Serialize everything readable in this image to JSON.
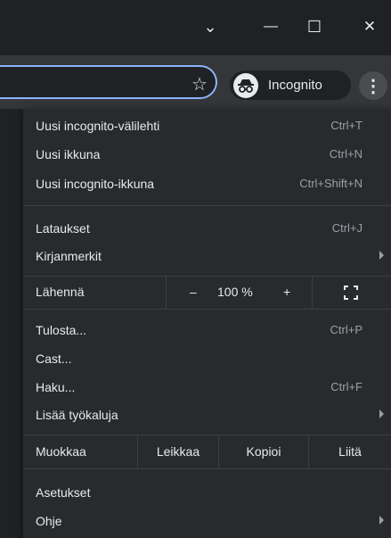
{
  "window": {
    "controls": [
      {
        "name": "tab-search-icon",
        "glyph": "⌄"
      },
      {
        "name": "minimize-icon",
        "glyph": "—"
      },
      {
        "name": "maximize-icon",
        "glyph": "☐"
      },
      {
        "name": "close-icon",
        "glyph": "✕"
      }
    ]
  },
  "toolbar": {
    "star_glyph": "☆",
    "incognito_label": "Incognito",
    "menu_glyph": "⋮"
  },
  "menu": {
    "group1": [
      {
        "label": "Uusi incognito-välilehti",
        "shortcut": "Ctrl+T"
      },
      {
        "label": "Uusi ikkuna",
        "shortcut": "Ctrl+N"
      },
      {
        "label": "Uusi incognito-ikkuna",
        "shortcut": "Ctrl+Shift+N"
      }
    ],
    "group2": [
      {
        "label": "Lataukset",
        "shortcut": "Ctrl+J"
      },
      {
        "label": "Kirjanmerkit",
        "shortcut": ""
      }
    ],
    "zoom": {
      "label": "Lähennä",
      "minus": "–",
      "value": "100 %",
      "plus": "+"
    },
    "group3": [
      {
        "label": "Tulosta...",
        "shortcut": "Ctrl+P"
      },
      {
        "label": "Cast...",
        "shortcut": ""
      },
      {
        "label": "Haku...",
        "shortcut": "Ctrl+F"
      },
      {
        "label": "Lisää työkaluja",
        "shortcut": ""
      }
    ],
    "edit": {
      "label": "Muokkaa",
      "cut": "Leikkaa",
      "copy": "Kopioi",
      "paste": "Liitä"
    },
    "group4": [
      {
        "label": "Asetukset",
        "shortcut": ""
      },
      {
        "label": "Ohje",
        "shortcut": ""
      }
    ]
  },
  "colors": {
    "accent": "#8ab4f8",
    "menu_bg": "#292a2d",
    "toolbar_bg": "#35363a",
    "titlebar_bg": "#202124"
  }
}
